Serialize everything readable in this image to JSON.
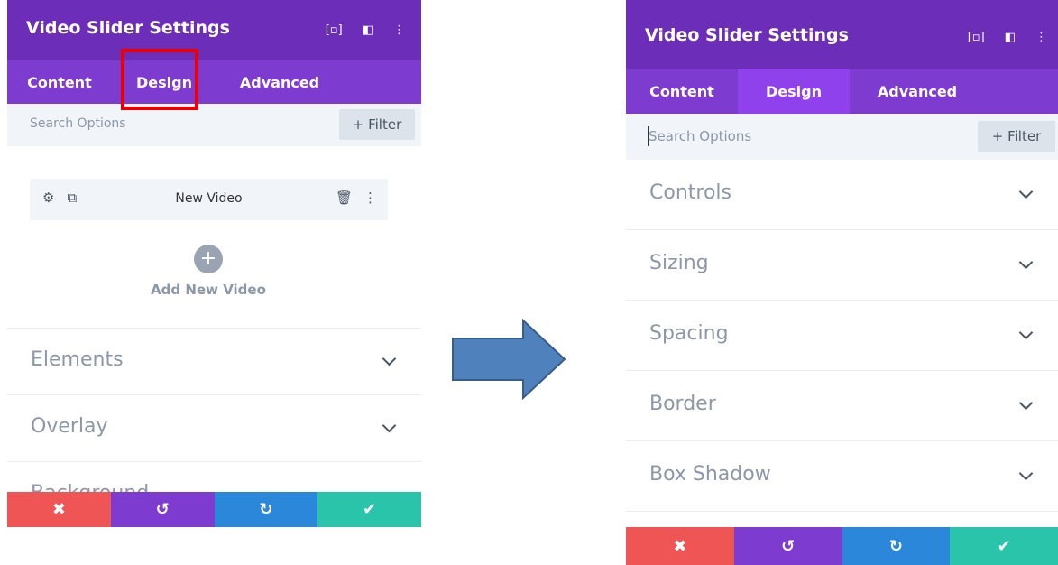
{
  "left_panel": {
    "title": "Video Slider Settings",
    "tabs": [
      "Content",
      "Design",
      "Advanced"
    ],
    "search_placeholder": "Search Options",
    "filter_label": "+ Filter",
    "video_item_label": "New Video",
    "add_new_label": "Add New Video",
    "sections": [
      "Elements",
      "Overlay",
      "Background"
    ]
  },
  "right_panel": {
    "title": "Video Slider Settings",
    "tabs": [
      "Content",
      "Design",
      "Advanced"
    ],
    "search_placeholder": "Search Options",
    "filter_label": "+ Filter",
    "sections": [
      "Controls",
      "Sizing",
      "Spacing",
      "Border",
      "Box Shadow"
    ]
  },
  "footer": {
    "cancel": "✖",
    "undo": "↺",
    "redo": "↻",
    "save": "✔"
  },
  "colors": {
    "title_bar": "#6c2eb9",
    "tab_bar": "#7e3bd0",
    "active_tab": "#8f42ec",
    "cancel": "#ef5555",
    "undo": "#7d3bcf",
    "redo": "#2b87da",
    "save": "#29c4a9",
    "highlight": "#ee0000",
    "arrow": "#4f81bd"
  }
}
